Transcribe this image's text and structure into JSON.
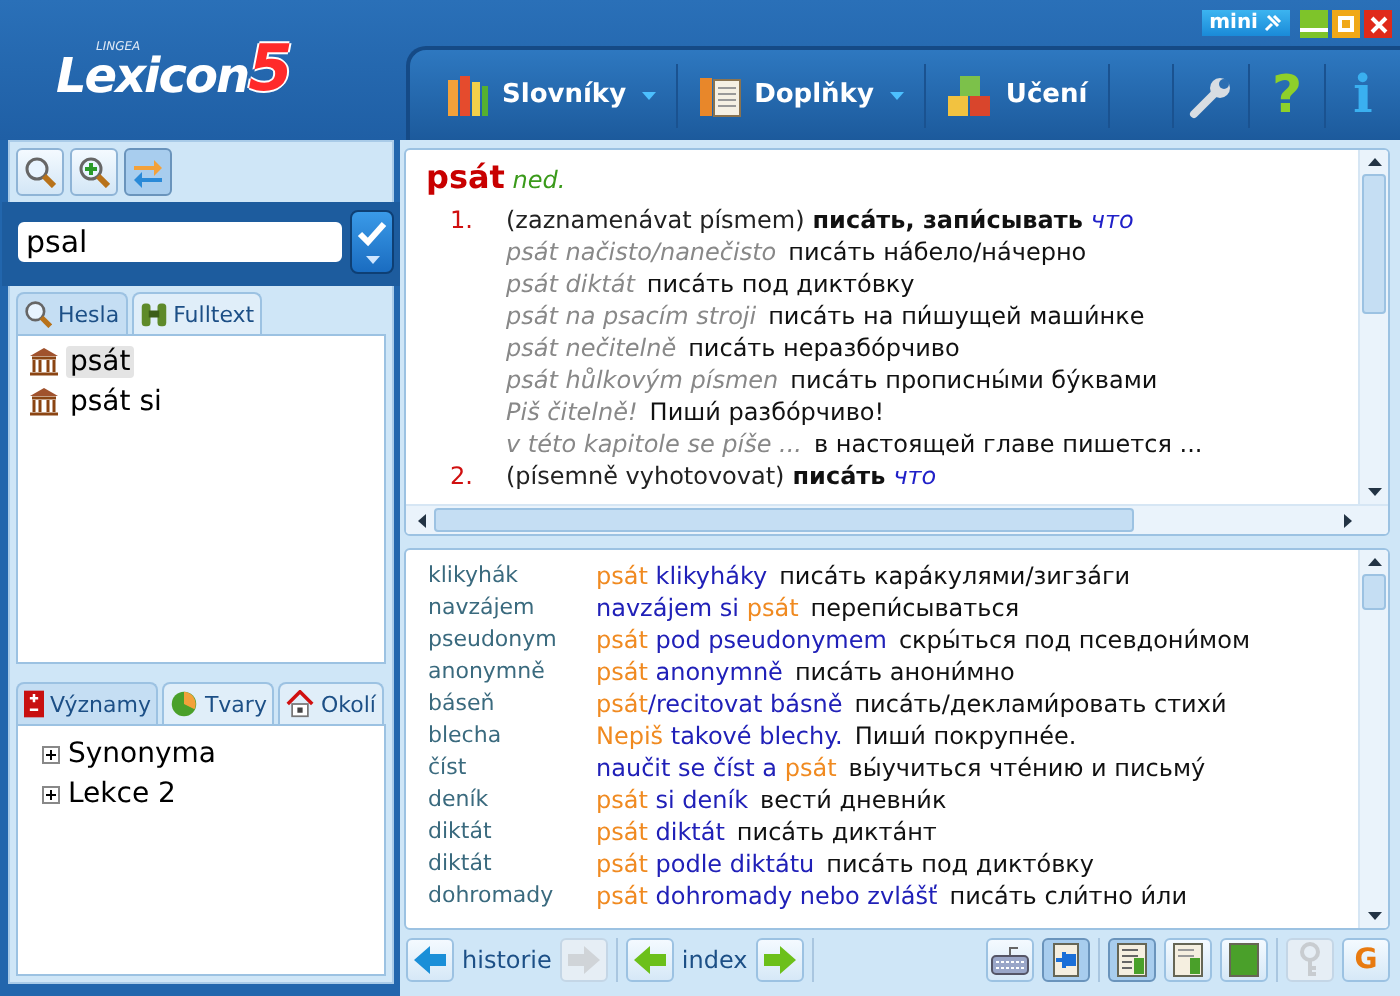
{
  "logo": {
    "brand": "LINGEA",
    "name": "Lexicon",
    "number": "5"
  },
  "window_controls": {
    "mini": "mini"
  },
  "menu": [
    {
      "label": "Slovníky",
      "kind": "books",
      "dropdown": true
    },
    {
      "label": "Doplňky",
      "kind": "supplement",
      "dropdown": true
    },
    {
      "label": "Učení",
      "kind": "blocks",
      "dropdown": false
    }
  ],
  "header_tools": [
    {
      "kind": "wrench"
    },
    {
      "kind": "help",
      "glyph": "?"
    },
    {
      "kind": "info",
      "glyph": "i"
    }
  ],
  "search_tools": [
    {
      "kind": "search",
      "selected": false
    },
    {
      "kind": "zoom-in",
      "selected": false
    },
    {
      "kind": "swap",
      "selected": true
    }
  ],
  "search": {
    "value": "psal"
  },
  "search_tabs": [
    {
      "label": "Hesla",
      "kind": "search",
      "selected": true
    },
    {
      "label": "Fulltext",
      "kind": "binoculars",
      "selected": false
    }
  ],
  "results": [
    {
      "text": "psát",
      "selected": true
    },
    {
      "text": "psát si",
      "selected": false
    }
  ],
  "info_tabs": [
    {
      "label": "Významy",
      "kind": "plusminus",
      "selected": true
    },
    {
      "label": "Tvary",
      "kind": "pie",
      "selected": false
    },
    {
      "label": "Okolí",
      "kind": "house",
      "selected": false
    }
  ],
  "tree": [
    {
      "label": "Synonyma",
      "expanded": false
    },
    {
      "label": "Lekce 2",
      "expanded": false
    }
  ],
  "entry": {
    "headword": "psát",
    "pos": "ned.",
    "senses": [
      {
        "number": "1.",
        "gloss": "(zaznamenávat písmem)",
        "translation": "писа́ть, запи́сывать",
        "object": "что",
        "examples": [
          {
            "cz": "psát načisto/nanečisto",
            "ru": "писа́ть на́бело/на́черно"
          },
          {
            "cz": "psát diktát",
            "ru": "писа́ть под дикто́вку"
          },
          {
            "cz": "psát na psacím stroji",
            "ru": "писа́ть на пи́шущей маши́нке"
          },
          {
            "cz": "psát nečitelně",
            "ru": "писа́ть неразбо́рчиво"
          },
          {
            "cz": "psát hůlkovým písmen",
            "ru": "писа́ть прописны́ми бу́квами"
          },
          {
            "cz": "Piš čitelně!",
            "ru": "Пиши́ разбо́рчиво!"
          },
          {
            "cz": "v této kapitole se píše ...",
            "ru": "в настоящей главе пишется ..."
          }
        ]
      },
      {
        "number": "2.",
        "gloss": "(písemně vyhotovovat)",
        "translation": "писа́ть",
        "object": "что"
      }
    ]
  },
  "phrases": [
    {
      "key": "klikyhák",
      "parts": [
        {
          "text": "psát",
          "kind": "head"
        },
        {
          "text": " klikyháky",
          "kind": "phrase"
        }
      ],
      "translation": "писа́ть кара́кулями/зигза́ги"
    },
    {
      "key": "navzájem",
      "parts": [
        {
          "text": "navzájem si ",
          "kind": "phrase"
        },
        {
          "text": "psát",
          "kind": "head"
        }
      ],
      "translation": "перепи́сываться"
    },
    {
      "key": "pseudonym",
      "parts": [
        {
          "text": "psát",
          "kind": "head"
        },
        {
          "text": " pod pseudonymem",
          "kind": "phrase"
        }
      ],
      "translation": "скры́ться под псевдони́мом"
    },
    {
      "key": "anonymně",
      "parts": [
        {
          "text": "psát",
          "kind": "head"
        },
        {
          "text": " anonymně",
          "kind": "phrase"
        }
      ],
      "translation": "писа́ть анони́мно"
    },
    {
      "key": "báseň",
      "parts": [
        {
          "text": "psát",
          "kind": "head"
        },
        {
          "text": "/recitovat básně",
          "kind": "phrase"
        }
      ],
      "translation": "писа́ть/деклами́ровать стихи́"
    },
    {
      "key": "blecha",
      "parts": [
        {
          "text": "Nepiš",
          "kind": "head"
        },
        {
          "text": " takové blechy.",
          "kind": "phrase"
        }
      ],
      "translation": "Пиши́ покрупне́е."
    },
    {
      "key": "číst",
      "parts": [
        {
          "text": "naučit se číst a ",
          "kind": "phrase"
        },
        {
          "text": "psát",
          "kind": "head"
        }
      ],
      "translation": "вы́учиться чте́нию и письму́"
    },
    {
      "key": "deník",
      "parts": [
        {
          "text": "psát",
          "kind": "head"
        },
        {
          "text": " si deník",
          "kind": "phrase"
        }
      ],
      "translation": "вести́ дневни́к"
    },
    {
      "key": "diktát",
      "parts": [
        {
          "text": "psát",
          "kind": "head"
        },
        {
          "text": " diktát",
          "kind": "phrase"
        }
      ],
      "translation": "писа́ть дикта́нт"
    },
    {
      "key": "diktát",
      "parts": [
        {
          "text": "psát",
          "kind": "head"
        },
        {
          "text": " podle diktátu",
          "kind": "phrase"
        }
      ],
      "translation": "писа́ть под дикто́вку"
    },
    {
      "key": "dohromady",
      "parts": [
        {
          "text": "psát",
          "kind": "head"
        },
        {
          "text": " dohromady nebo zvlášť",
          "kind": "phrase"
        }
      ],
      "translation": "писа́ть сли́тно и́ли"
    }
  ],
  "bottom_toolbar": {
    "nav": [
      {
        "label": "historie",
        "color": "#1a8fd8",
        "back_disabled": false,
        "forward_disabled": true
      },
      {
        "label": "index",
        "color": "#6cc01a",
        "back_disabled": false,
        "forward_disabled": false
      }
    ],
    "tool_groups": [
      {
        "tools": [
          {
            "kind": "keyboard",
            "selected": false,
            "disabled": false
          },
          {
            "kind": "pin",
            "selected": true,
            "disabled": false
          }
        ]
      },
      {
        "tools": [
          {
            "kind": "notebook-lines",
            "selected": true,
            "disabled": false
          },
          {
            "kind": "notebook-page",
            "selected": false,
            "disabled": false
          },
          {
            "kind": "notebook-filled",
            "selected": false,
            "disabled": false
          }
        ]
      },
      {
        "tools": [
          {
            "kind": "key",
            "selected": false,
            "disabled": true
          },
          {
            "kind": "letter",
            "glyph": "G",
            "selected": false,
            "disabled": false
          }
        ]
      }
    ]
  }
}
